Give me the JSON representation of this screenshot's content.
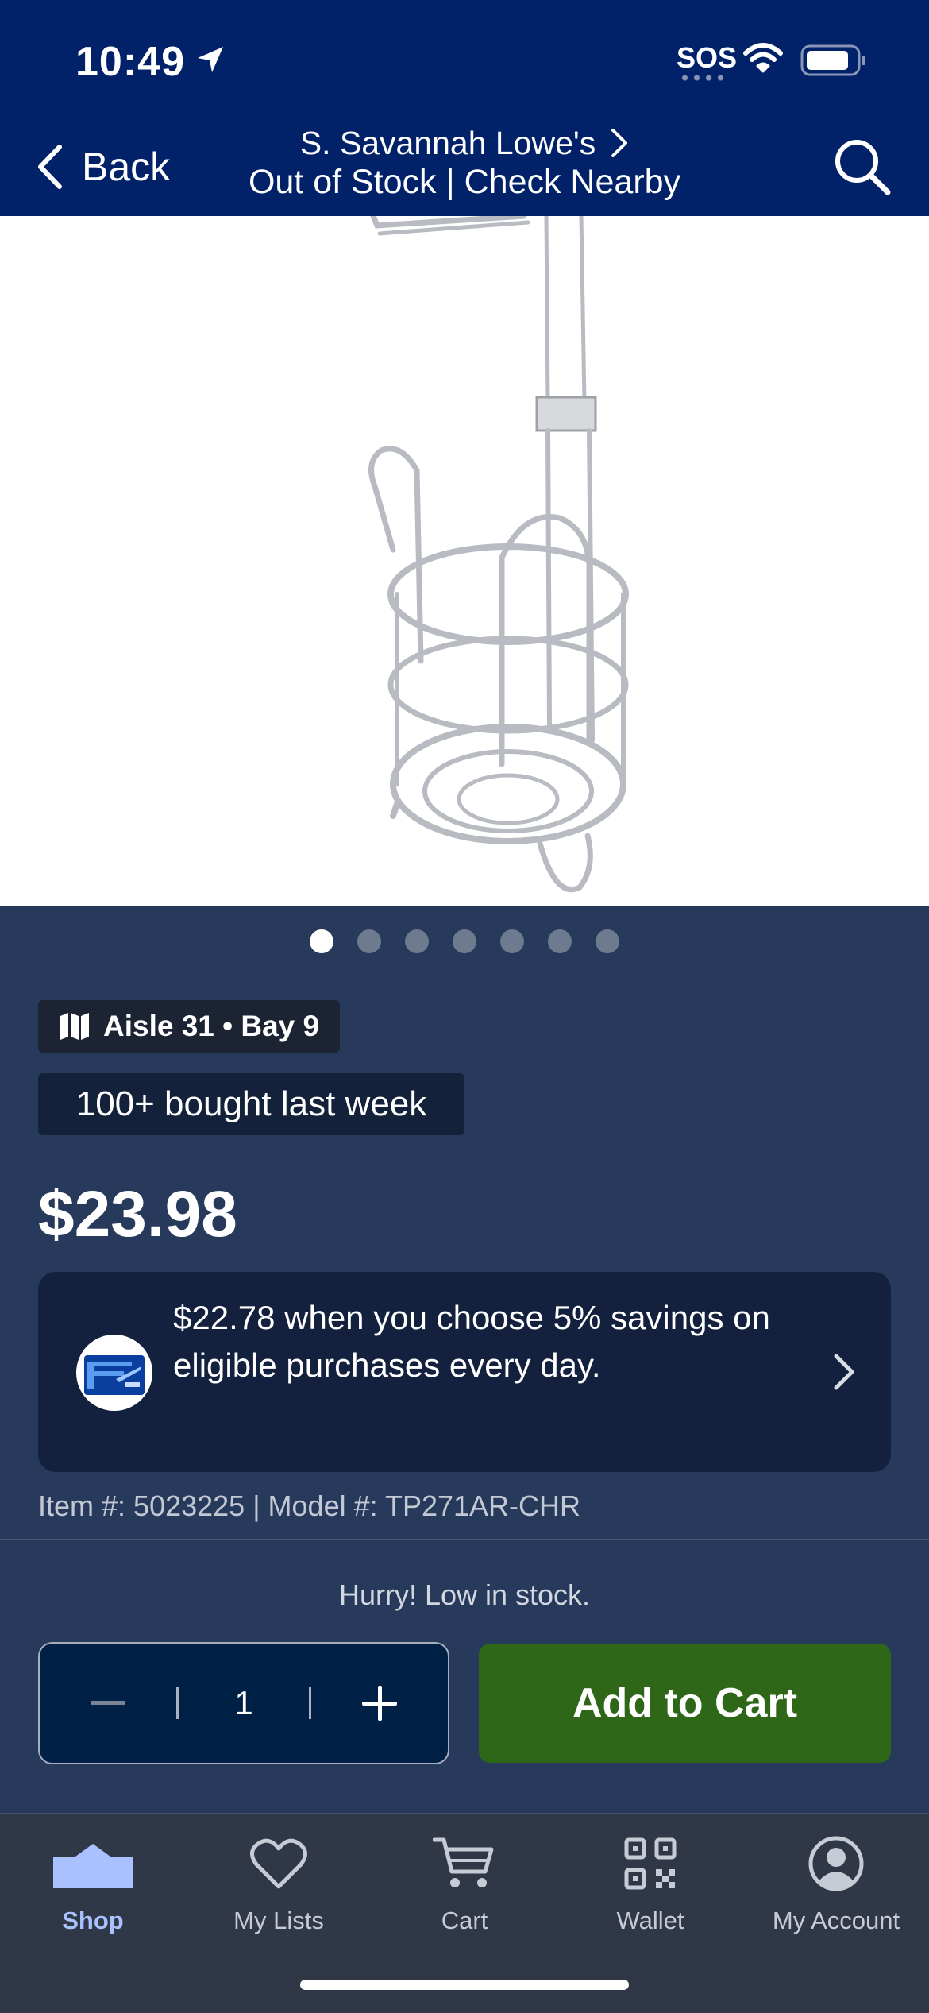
{
  "status_bar": {
    "time": "10:49",
    "sos": "SOS"
  },
  "nav": {
    "back_label": "Back",
    "store_name": "S. Savannah Lowe's",
    "store_status": "Out of Stock | Check Nearby"
  },
  "carousel": {
    "total": 7,
    "active_index": 1
  },
  "product": {
    "aisle": "Aisle 31 • Bay 9",
    "bought": "100+ bought last week",
    "price": "$23.98",
    "savings": "$22.78 when you choose 5% savings on eligible purchases every day.",
    "item_model": "Item #: 5023225 | Model #: TP271AR-CHR",
    "low_stock": "Hurry! Low in stock."
  },
  "cart": {
    "quantity": "1",
    "add_label": "Add to Cart"
  },
  "tabs": [
    {
      "label": "Shop",
      "icon": "shop-icon",
      "active": true
    },
    {
      "label": "My Lists",
      "icon": "heart-icon",
      "active": false
    },
    {
      "label": "Cart",
      "icon": "cart-icon",
      "active": false
    },
    {
      "label": "Wallet",
      "icon": "qr-code-icon",
      "active": false
    },
    {
      "label": "My Account",
      "icon": "account-icon",
      "active": false
    }
  ],
  "colors": {
    "brand_navy": "#012169",
    "background": "#273a5b",
    "add_to_cart_green": "#2e6718",
    "active_tab": "#a9c1ff"
  }
}
